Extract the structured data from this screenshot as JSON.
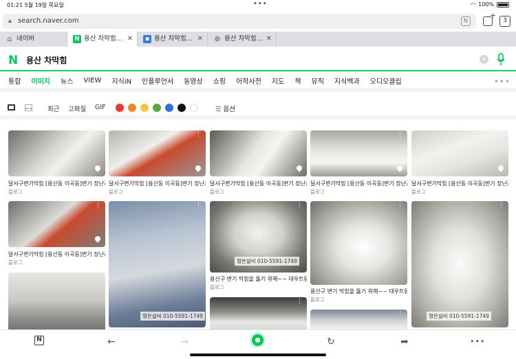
{
  "status": {
    "time": "01:21",
    "date": "5월 19일 목요일",
    "battery": "100%"
  },
  "urlbar": {
    "url": "search.naver.com",
    "lock_icon": "lock-icon",
    "tab_count": "3"
  },
  "tabs": [
    {
      "title": "네이버",
      "icon": "home-icon",
      "active": false
    },
    {
      "title": "용산 차막힘...",
      "icon": "naver-n-icon",
      "active": true
    },
    {
      "title": "용산 차막힘...",
      "icon": "naver-image-icon",
      "active": false
    },
    {
      "title": "용산 차막힘...",
      "icon": "globe-icon",
      "active": false
    }
  ],
  "search": {
    "logo": "N",
    "query": "용산 차막힘"
  },
  "nav": [
    "통합",
    "이미지",
    "뉴스",
    "VIEW",
    "지식iN",
    "인플루언서",
    "동영상",
    "쇼핑",
    "어학사전",
    "지도",
    "책",
    "뮤직",
    "지식백과",
    "오디오클립"
  ],
  "nav_active": "이미지",
  "filters": {
    "recent": "최근",
    "hires": "고화질",
    "gif": "GIF",
    "options": "옵션",
    "colors": [
      "#e53b2c",
      "#f08a24",
      "#f2c744",
      "#58a83b",
      "#2f6fe0",
      "#111111",
      "#ffffff"
    ]
  },
  "cards": [
    {
      "caption": "달서구변기막힘 [용산동 이곡동]변기 장난감...",
      "source": "블로그"
    },
    {
      "caption": "달서구변기막힘 [용산동 이곡동]변기 장난감...",
      "source": "블로그"
    },
    {
      "caption": "달서구변기막힘 [용산동 이곡동]변기 장난감...",
      "source": "블로그"
    },
    {
      "caption": "달서구변기막힘 [용산동 이곡동]변기 장난감...",
      "source": "블로그"
    },
    {
      "caption": "달서구변기막힘 [용산동 이곡동]변기 장난감...",
      "source": "블로그"
    },
    {
      "caption": "달서구변기막힘 [용산동 이곡동]변기 장난감...",
      "source": "블로그"
    },
    {
      "caption": "용산구 변기 막힘을 뚫기 위해~~ 대우트럼...",
      "source": "블로그",
      "watermark": "형은설비 010-5591-1749"
    },
    {
      "caption": "용산구 변기 막힘을 뚫기 위해~~ 대우트럼...",
      "source": "블로그"
    },
    {
      "watermark": "형은설비 010-5591-1749"
    },
    {
      "watermark": "형은설비 010-5591-1749"
    }
  ]
}
